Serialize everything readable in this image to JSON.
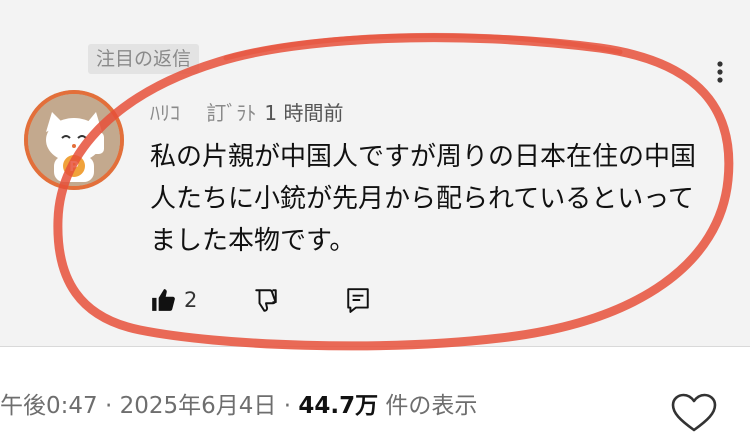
{
  "comment": {
    "pinned_label": "注目の返信",
    "author": "ﾊﾘｺ　 訂ﾞﾗﾄ",
    "time": "1 時間前",
    "text": "私の片親が中国人ですが周りの日本在住の中国人たちに小銃が先月から配られているといってました本物です。",
    "like_count": "2"
  },
  "post_meta": {
    "time": "午後0:47",
    "separator": "·",
    "date": "2025年6月4日",
    "views": "44.7万",
    "views_suffix": "件の表示"
  },
  "colors": {
    "highlight": "#e6503a",
    "avatar_ring": "#e36f3a",
    "card_bg": "#f3f3f3"
  },
  "icons": [
    "more-vertical-icon",
    "avatar-cat-icon",
    "thumbs-up-icon",
    "thumbs-down-icon",
    "reply-icon",
    "heart-icon"
  ]
}
